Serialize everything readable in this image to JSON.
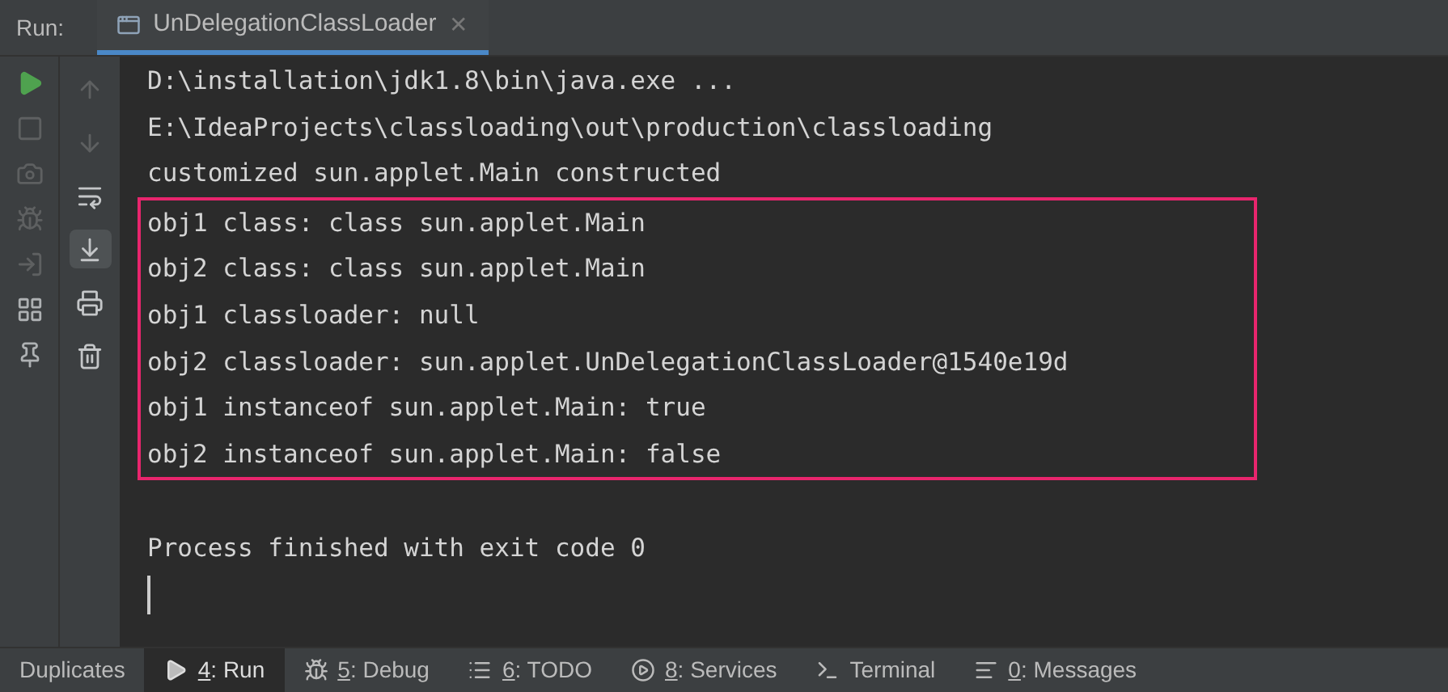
{
  "run_label": "Run:",
  "tab": {
    "title": "UnDelegationClassLoader",
    "close": "✕",
    "selected": true
  },
  "toolbar_left": [
    {
      "kind": "run",
      "disabled": false
    },
    {
      "kind": "stop",
      "disabled": true
    },
    {
      "kind": "camera",
      "disabled": true
    },
    {
      "kind": "debug",
      "disabled": true
    },
    {
      "kind": "exit",
      "disabled": true
    },
    {
      "kind": "layout",
      "disabled": false
    },
    {
      "kind": "pin",
      "disabled": false
    }
  ],
  "toolbar_right": [
    {
      "kind": "up",
      "disabled": true,
      "selected": false
    },
    {
      "kind": "down",
      "disabled": true,
      "selected": false
    },
    {
      "kind": "wrap",
      "disabled": false,
      "selected": false
    },
    {
      "kind": "scroll",
      "disabled": false,
      "selected": true
    },
    {
      "kind": "print",
      "disabled": false,
      "selected": false
    },
    {
      "kind": "trash",
      "disabled": false,
      "selected": false
    }
  ],
  "console": {
    "lines_before": [
      "D:\\installation\\jdk1.8\\bin\\java.exe ...",
      "E:\\IdeaProjects\\classloading\\out\\production\\classloading",
      "customized sun.applet.Main constructed"
    ],
    "highlighted_lines": [
      "obj1 class: class sun.applet.Main",
      "obj2 class: class sun.applet.Main",
      "obj1 classloader: null",
      "obj2 classloader: sun.applet.UnDelegationClassLoader@1540e19d",
      "obj1 instanceof sun.applet.Main: true",
      "obj2 instanceof sun.applet.Main: false"
    ],
    "lines_after": [
      "Process finished with exit code 0"
    ]
  },
  "bottom_tabs": [
    {
      "kind": "plain",
      "label": "Duplicates",
      "selected": false
    },
    {
      "kind": "run",
      "mnemonic": "4",
      "label": ": Run",
      "selected": true
    },
    {
      "kind": "debug",
      "mnemonic": "5",
      "label": ": Debug",
      "selected": false
    },
    {
      "kind": "todo",
      "mnemonic": "6",
      "label": ": TODO",
      "selected": false
    },
    {
      "kind": "services",
      "mnemonic": "8",
      "label": ": Services",
      "selected": false
    },
    {
      "kind": "terminal",
      "label": "Terminal",
      "selected": false
    },
    {
      "kind": "messages",
      "mnemonic": "0",
      "label": ": Messages",
      "selected": false
    }
  ]
}
